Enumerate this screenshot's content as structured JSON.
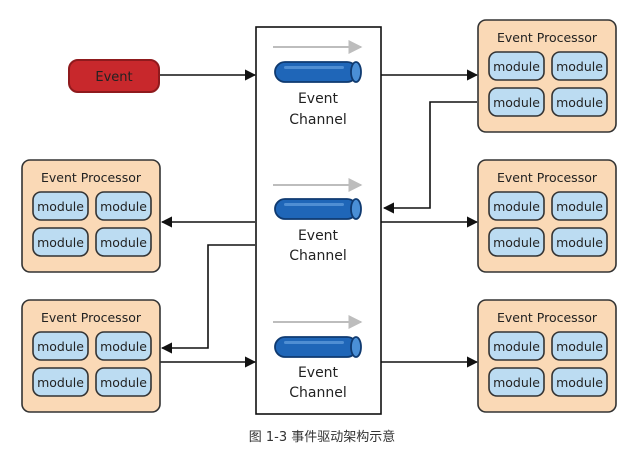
{
  "event": {
    "label": "Event"
  },
  "channel": {
    "label_line1": "Event",
    "label_line2": "Channel"
  },
  "processor": {
    "title": "Event Processor",
    "module": "module"
  },
  "caption": "图 1-3 事件驱动架构示意",
  "colors": {
    "event_fill": "#c8282c",
    "event_border": "#8f1a1d",
    "processor_fill": "#fad9b6",
    "processor_border": "#333333",
    "module_fill": "#bcdcf2",
    "module_border": "#333333",
    "pipe_fill": "#1f66b8",
    "pipe_border": "#0f3a70",
    "hint_arrow": "#bdbdbd",
    "line": "#111111"
  }
}
